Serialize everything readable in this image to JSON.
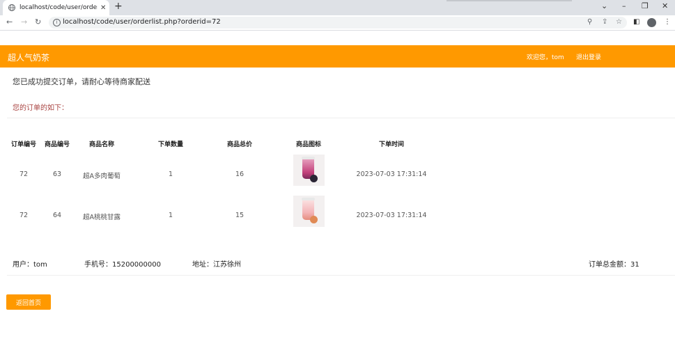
{
  "browser": {
    "tab_title": "localhost/code/user/orderlist.p",
    "tab_close": "✕",
    "new_tab": "+",
    "url": "localhost/code/user/orderlist.php?orderid=72",
    "window_controls": [
      "⌄",
      "–",
      "❐",
      "✕"
    ]
  },
  "header": {
    "site_title": "超人气奶茶",
    "welcome": "欢迎您，tom",
    "logout": "退出登录",
    "accent_color": "#ff9900"
  },
  "main": {
    "success_message": "您已成功提交订单，请耐心等待商家配送",
    "subheading": "您的订单的如下："
  },
  "table": {
    "columns": [
      "订单编号",
      "商品编号",
      "商品名称",
      "下单数量",
      "商品总价",
      "商品图标",
      "下单时间"
    ],
    "rows": [
      {
        "order_id": "72",
        "product_id": "63",
        "name": "超A多肉葡萄",
        "quantity": "1",
        "total": "16",
        "image": "grape-milk-tea-image",
        "time": "2023-07-03 17:31:14"
      },
      {
        "order_id": "72",
        "product_id": "64",
        "name": "超A桃桃甘露",
        "quantity": "1",
        "total": "15",
        "image": "peach-milk-tea-image",
        "time": "2023-07-03 17:31:14"
      }
    ]
  },
  "summary": {
    "user": "用户：tom",
    "phone": "手机号：15200000000",
    "address": "地址：江苏徐州",
    "total": "订单总金额：31"
  },
  "back_button": "返回首页"
}
